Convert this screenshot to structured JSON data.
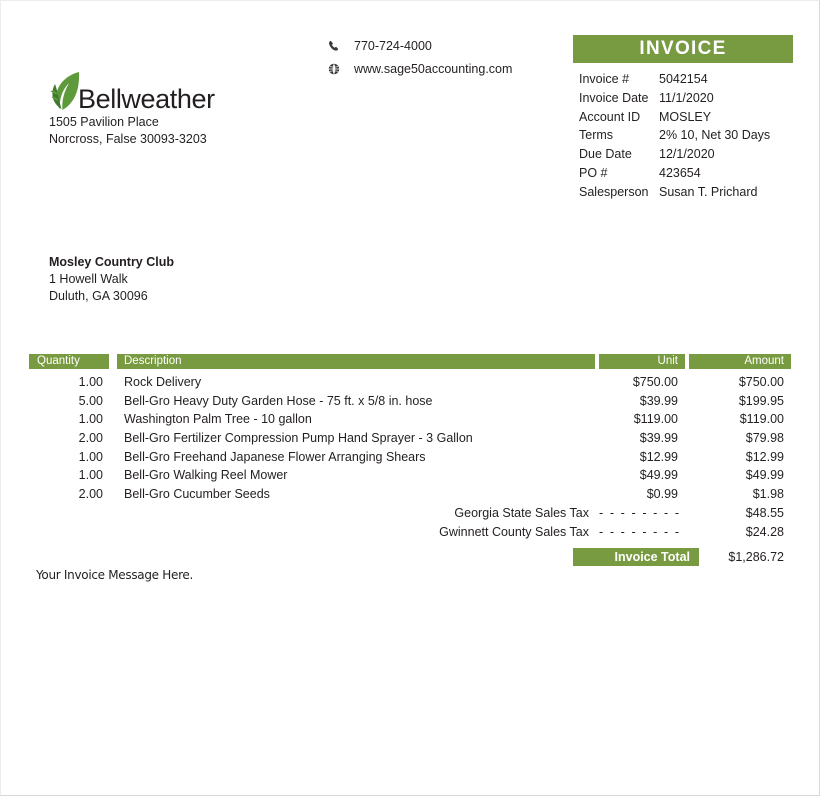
{
  "company": {
    "name": "Bellweather",
    "address_line1": "1505 Pavilion Place",
    "address_line2": "Norcross, False 30093-3203",
    "logo_icon": "leaf-icon"
  },
  "contact": {
    "phone_icon": "phone-icon",
    "phone": "770-724-4000",
    "web_icon": "globe-icon",
    "website": "www.sage50accounting.com"
  },
  "invoice_header": {
    "banner_title": "INVOICE",
    "fields": [
      {
        "label": "Invoice #",
        "value": "5042154"
      },
      {
        "label": "Invoice Date",
        "value": "11/1/2020"
      },
      {
        "label": "Account ID",
        "value": "MOSLEY"
      },
      {
        "label": "Terms",
        "value": "2% 10, Net 30 Days"
      },
      {
        "label": "Due Date",
        "value": "12/1/2020"
      },
      {
        "label": "PO #",
        "value": "423654"
      },
      {
        "label": "Salesperson",
        "value": "Susan T. Prichard"
      }
    ]
  },
  "bill_to": {
    "name": "Mosley Country Club",
    "line1": "1 Howell Walk",
    "line2": "Duluth, GA 30096"
  },
  "items_table": {
    "columns": {
      "quantity": "Quantity",
      "description": "Description",
      "unit": "Unit",
      "amount": "Amount"
    },
    "rows": [
      {
        "quantity": "1.00",
        "description": "Rock Delivery",
        "unit": "$750.00",
        "amount": "$750.00"
      },
      {
        "quantity": "5.00",
        "description": "Bell-Gro Heavy Duty Garden Hose - 75 ft. x 5/8 in. hose",
        "unit": "$39.99",
        "amount": "$199.95"
      },
      {
        "quantity": "1.00",
        "description": "Washington Palm Tree - 10 gallon",
        "unit": "$119.00",
        "amount": "$119.00"
      },
      {
        "quantity": "2.00",
        "description": "Bell-Gro Fertilizer Compression Pump Hand Sprayer - 3 Gallon",
        "unit": "$39.99",
        "amount": "$79.98"
      },
      {
        "quantity": "1.00",
        "description": "Bell-Gro Freehand Japanese Flower Arranging Shears",
        "unit": "$12.99",
        "amount": "$12.99"
      },
      {
        "quantity": "1.00",
        "description": "Bell-Gro Walking Reel Mower",
        "unit": "$49.99",
        "amount": "$49.99"
      },
      {
        "quantity": "2.00",
        "description": "Bell-Gro Cucumber Seeds",
        "unit": "$0.99",
        "amount": "$1.98"
      }
    ],
    "taxes": [
      {
        "label": "Georgia State Sales Tax",
        "separator": "- - - - - - - - - -",
        "amount": "$48.55"
      },
      {
        "label": "Gwinnett County Sales Tax",
        "separator": "- - - - - - - - - -",
        "amount": "$24.28"
      }
    ],
    "total": {
      "label": "Invoice Total",
      "amount": "$1,286.72"
    }
  },
  "footer": {
    "message": "Your Invoice Message Here."
  },
  "colors": {
    "accent_green": "#789a40",
    "text": "#231f20",
    "page_border": "#d8d8d8"
  }
}
